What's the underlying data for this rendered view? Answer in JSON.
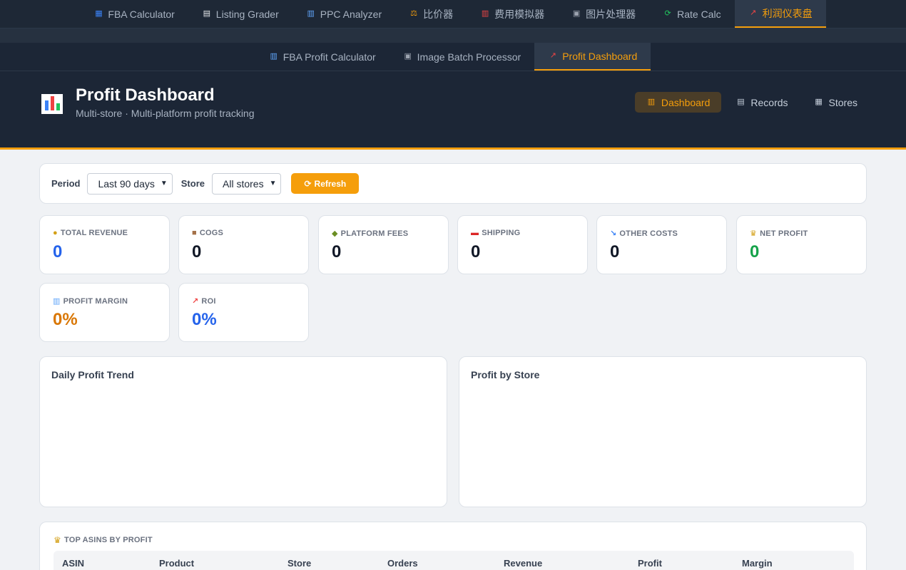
{
  "top_nav": [
    {
      "label": "FBA Calculator",
      "icon": "calculator-icon",
      "glyph": "▦",
      "color": "#3b82f6",
      "active": false
    },
    {
      "label": "Listing Grader",
      "icon": "document-icon",
      "glyph": "▤",
      "color": "#e5e7eb",
      "active": false
    },
    {
      "label": "PPC Analyzer",
      "icon": "bar-chart-icon",
      "glyph": "▥",
      "color": "#60a5fa",
      "active": false
    },
    {
      "label": "比价器",
      "icon": "scale-icon",
      "glyph": "⚖",
      "color": "#f59e0b",
      "active": false
    },
    {
      "label": "费用模拟器",
      "icon": "abacus-icon",
      "glyph": "▥",
      "color": "#ef4444",
      "active": false
    },
    {
      "label": "图片处理器",
      "icon": "picture-icon",
      "glyph": "▣",
      "color": "#9ca3af",
      "active": false
    },
    {
      "label": "Rate Calc",
      "icon": "refresh-icon",
      "glyph": "⟳",
      "color": "#22c55e",
      "active": false
    },
    {
      "label": "利润仪表盘",
      "icon": "trend-icon",
      "glyph": "↗",
      "color": "#ef4444",
      "active": true
    }
  ],
  "sub_nav": [
    {
      "label": "FBA Profit Calculator",
      "icon": "bar-chart-icon",
      "glyph": "▥",
      "color": "#60a5fa",
      "active": false
    },
    {
      "label": "Image Batch Processor",
      "icon": "picture-icon",
      "glyph": "▣",
      "color": "#9ca3af",
      "active": false
    },
    {
      "label": "Profit Dashboard",
      "icon": "trend-icon",
      "glyph": "↗",
      "color": "#ef4444",
      "active": true
    }
  ],
  "header": {
    "title": "Profit Dashboard",
    "subtitle": "Multi-store · Multi-platform profit tracking",
    "views": [
      {
        "label": "Dashboard",
        "icon": "bar-chart-icon",
        "glyph": "▥",
        "active": true
      },
      {
        "label": "Records",
        "icon": "clipboard-icon",
        "glyph": "▤",
        "active": false
      },
      {
        "label": "Stores",
        "icon": "store-icon",
        "glyph": "▦",
        "active": false
      }
    ]
  },
  "filters": {
    "period_label": "Period",
    "period_value": "Last 90 days",
    "store_label": "Store",
    "store_value": "All stores",
    "refresh_label": "Refresh"
  },
  "stats": [
    {
      "label": "TOTAL REVENUE",
      "value": "0",
      "icon": "money-bag-icon",
      "glyph": "●",
      "icon_color": "#d4a017",
      "value_color": "#2563eb"
    },
    {
      "label": "COGS",
      "value": "0",
      "icon": "box-icon",
      "glyph": "■",
      "icon_color": "#a47148",
      "value_color": "#111827"
    },
    {
      "label": "PLATFORM FEES",
      "value": "0",
      "icon": "store-icon",
      "glyph": "◆",
      "icon_color": "#6b8e23",
      "value_color": "#111827"
    },
    {
      "label": "SHIPPING",
      "value": "0",
      "icon": "truck-icon",
      "glyph": "▬",
      "icon_color": "#dc2626",
      "value_color": "#111827"
    },
    {
      "label": "OTHER COSTS",
      "value": "0",
      "icon": "chart-down-icon",
      "glyph": "↘",
      "icon_color": "#3b82f6",
      "value_color": "#111827"
    },
    {
      "label": "NET PROFIT",
      "value": "0",
      "icon": "trophy-icon",
      "glyph": "♛",
      "icon_color": "#d4a017",
      "value_color": "#16a34a"
    },
    {
      "label": "PROFIT MARGIN",
      "value": "0%",
      "icon": "bar-chart-icon",
      "glyph": "▥",
      "icon_color": "#60a5fa",
      "value_color": "#d97706"
    },
    {
      "label": "ROI",
      "value": "0%",
      "icon": "trend-icon",
      "glyph": "↗",
      "icon_color": "#ef4444",
      "value_color": "#2563eb"
    }
  ],
  "charts": {
    "daily_title": "Daily Profit Trend",
    "store_title": "Profit by Store"
  },
  "top_asins": {
    "title": "TOP ASINS BY PROFIT",
    "columns": [
      "ASIN",
      "Product",
      "Store",
      "Orders",
      "Revenue",
      "Profit",
      "Margin"
    ]
  },
  "colors": {
    "accent": "#f59e0b",
    "nav_bg": "#1e2836",
    "page_bg": "#f0f2f5"
  }
}
